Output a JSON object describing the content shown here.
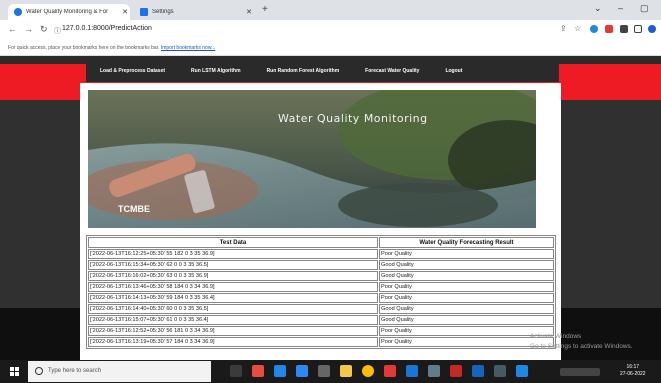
{
  "browser": {
    "tabs": [
      {
        "title": "Water Quality Monitoring & For",
        "active": true
      },
      {
        "title": "Settings",
        "active": false
      }
    ],
    "url": "127.0.0.1:8000/PredictAction",
    "bookmarks_bar_text": "For quick access, place your bookmarks here on the bookmarks bar.",
    "bookmarks_link": "Import bookmarks now..."
  },
  "nav": {
    "items": [
      "Load & Preprocess Dataset",
      "Run LSTM Algorithm",
      "Run Random Forest Algorithm",
      "Forecast Water Quality",
      "Logout"
    ]
  },
  "hero": {
    "title": "Water Quality Monitoring",
    "logo_text": "TCMBE"
  },
  "table": {
    "headers": [
      "Test Data",
      "Water Quality Forecasting Result"
    ],
    "rows": [
      [
        "['2022-06-13T16:12:25+05:30' 55 182 0 3 35 36.9]",
        "Poor Quality"
      ],
      [
        "['2022-06-13T16:15:34+05:30' 62 0 0 3 35 36.5]",
        "Good Quality"
      ],
      [
        "['2022-06-13T16:16:02+05:30' 63 0 0 3 35 36.9]",
        "Good Quality"
      ],
      [
        "['2022-06-13T16:13:46+05:30' 58 184 0 3 34 36.9]",
        "Poor Quality"
      ],
      [
        "['2022-06-13T16:14:13+05:30' 59 184 0 3 35 36.4]",
        "Poor Quality"
      ],
      [
        "['2022-06-13T16:14:40+05:30' 60 0 0 3 35 36.5]",
        "Good Quality"
      ],
      [
        "['2022-06-13T16:15:07+05:30' 61 0 0 3 35 36.4]",
        "Good Quality"
      ],
      [
        "['2022-06-13T16:12:52+05:30' 56 181 0 3 34 36.9]",
        "Poor Quality"
      ],
      [
        "['2022-06-13T16:13:19+05:30' 57 184 0 3 34 36.9]",
        "Poor Quality"
      ]
    ]
  },
  "watermark": {
    "line1": "Activate Windows",
    "line2": "Go to Settings to activate Windows."
  },
  "taskbar": {
    "search_placeholder": "Type here to search",
    "time": "16:17",
    "date": "27-06-2022"
  },
  "colors": {
    "red_band": "#ee1b24",
    "menu_bg": "#2a2a2a"
  }
}
